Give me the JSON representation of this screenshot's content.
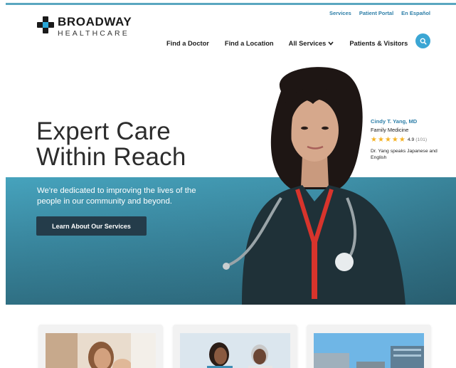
{
  "header": {
    "logo": {
      "name": "BROADWAY",
      "sub": "HEALTHCARE"
    },
    "utility_links": [
      "Services",
      "Patient Portal",
      "En Español"
    ],
    "nav": [
      {
        "label": "Find a Doctor"
      },
      {
        "label": "Find a Location"
      },
      {
        "label": "All Services",
        "has_dropdown": true
      },
      {
        "label": "Patients & Visitors"
      }
    ],
    "search_icon": "search-icon"
  },
  "hero": {
    "title_line1": "Expert Care",
    "title_line2": "Within Reach",
    "subtitle": "We're dedicated to improving the lives of the people in our community and beyond.",
    "button_label": "Learn About Our Services"
  },
  "doctor_card": {
    "name": "Cindy T. Yang, MD",
    "specialty": "Family Medicine",
    "rating": "4.9",
    "rating_count": "(101)",
    "languages": "Dr. Yang speaks Japanese and English"
  },
  "colors": {
    "accent": "#2aa7d8",
    "link": "#2e7fa8",
    "button": "#243c4a",
    "hero_band": "#3b8aa2",
    "star": "#f5b324"
  }
}
